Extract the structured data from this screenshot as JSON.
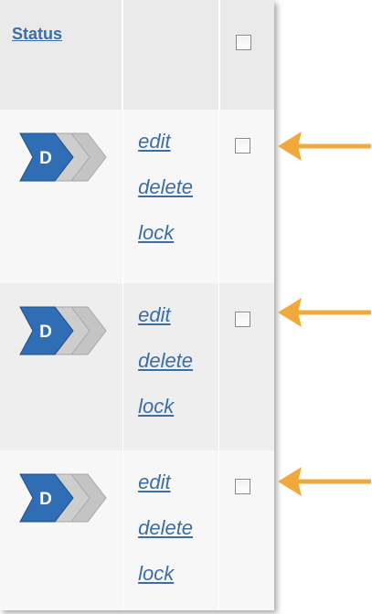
{
  "table": {
    "header": {
      "status_label": "Status"
    },
    "rows": [
      {
        "status_letter": "D",
        "actions": {
          "edit": "edit",
          "delete": "delete",
          "lock": "lock"
        }
      },
      {
        "status_letter": "D",
        "actions": {
          "edit": "edit",
          "delete": "delete",
          "lock": "lock"
        }
      },
      {
        "status_letter": "D",
        "actions": {
          "edit": "edit",
          "delete": "delete",
          "lock": "lock"
        }
      }
    ]
  },
  "colors": {
    "link": "#3a6ea5",
    "status_active": "#2f6db5",
    "status_inactive": "#c4c4c4",
    "arrow": "#f2a93b"
  },
  "icons": {
    "status": "workflow-stage-chevrons-icon",
    "pointer": "left-arrow-icon"
  }
}
